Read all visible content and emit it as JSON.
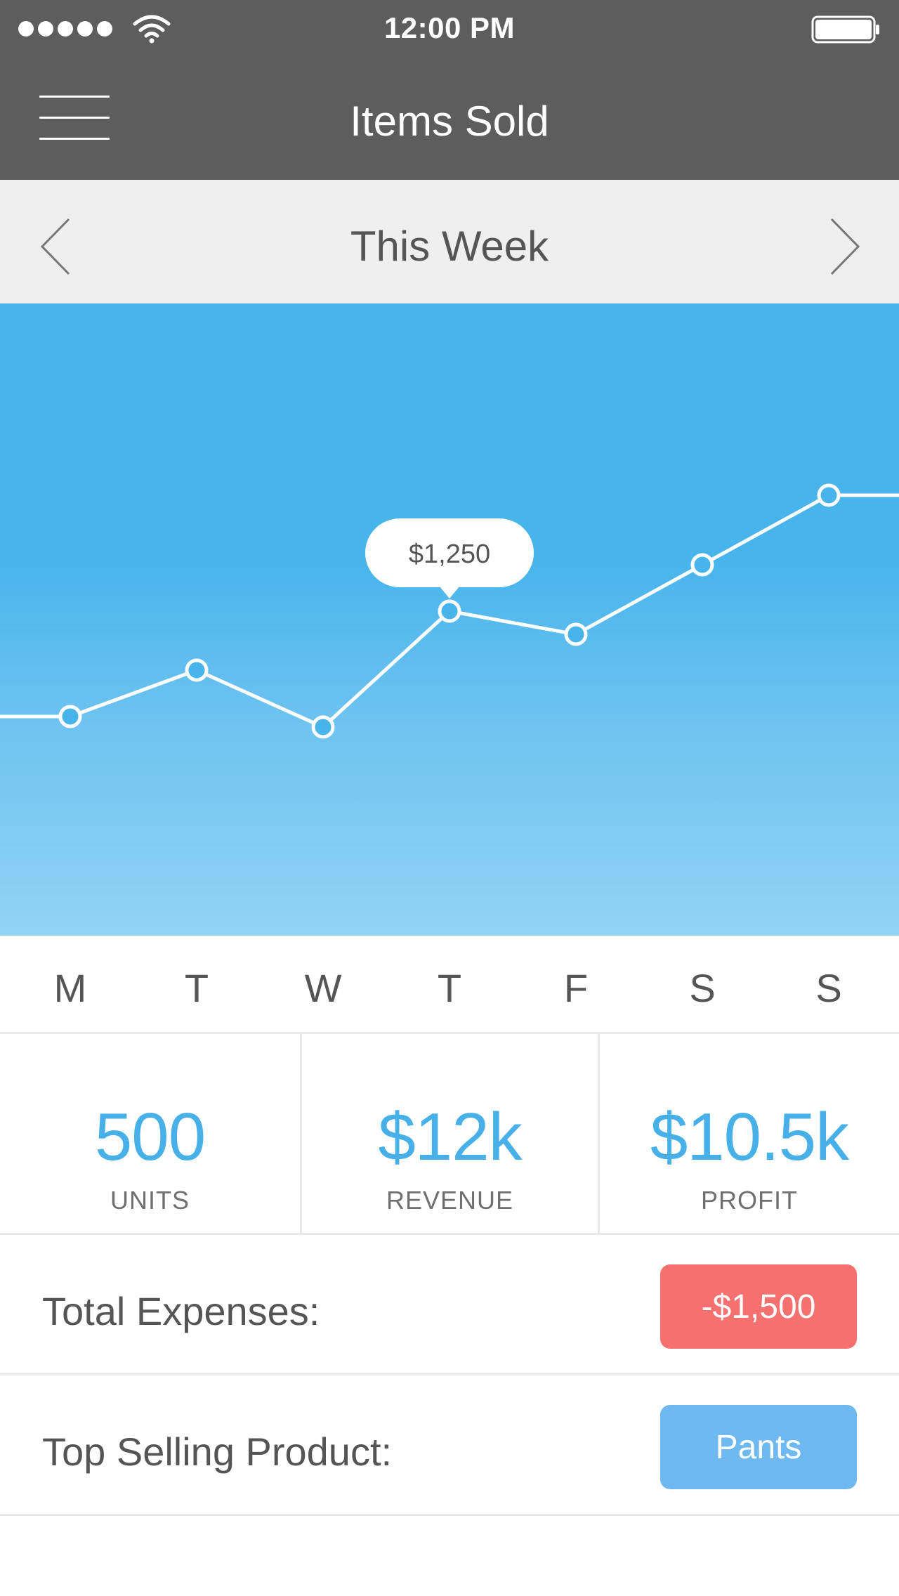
{
  "status_bar": {
    "time": "12:00 PM",
    "signal_icon": "signal-dots-icon",
    "wifi_icon": "wifi-icon",
    "battery_icon": "battery-icon"
  },
  "navbar": {
    "title": "Items Sold",
    "menu_icon": "hamburger-menu-icon"
  },
  "period": {
    "label": "This Week",
    "prev_icon": "chevron-left-icon",
    "next_icon": "chevron-right-icon"
  },
  "chart_data": {
    "type": "line",
    "categories": [
      "M",
      "T",
      "W",
      "T",
      "F",
      "S",
      "S"
    ],
    "values": [
      1000,
      1110,
      975,
      1250,
      1195,
      1360,
      1525
    ],
    "highlight": {
      "index": 3,
      "label": "$1,250"
    },
    "line_color": "#ffffff",
    "background_color": "#47b4ec",
    "grid": false
  },
  "days": [
    "M",
    "T",
    "W",
    "T",
    "F",
    "S",
    "S"
  ],
  "stats": [
    {
      "value": "500",
      "label": "UNITS"
    },
    {
      "value": "$12k",
      "label": "REVENUE"
    },
    {
      "value": "$10.5k",
      "label": "PROFIT"
    }
  ],
  "rows": {
    "expenses": {
      "label": "Total Expenses:",
      "value": "-$1,500",
      "color": "#f47170"
    },
    "top_product": {
      "label": "Top Selling Product:",
      "value": "Pants",
      "color": "#6fb9f1"
    }
  },
  "colors": {
    "header": "#5d5d5d",
    "accent": "#47b0e9"
  }
}
